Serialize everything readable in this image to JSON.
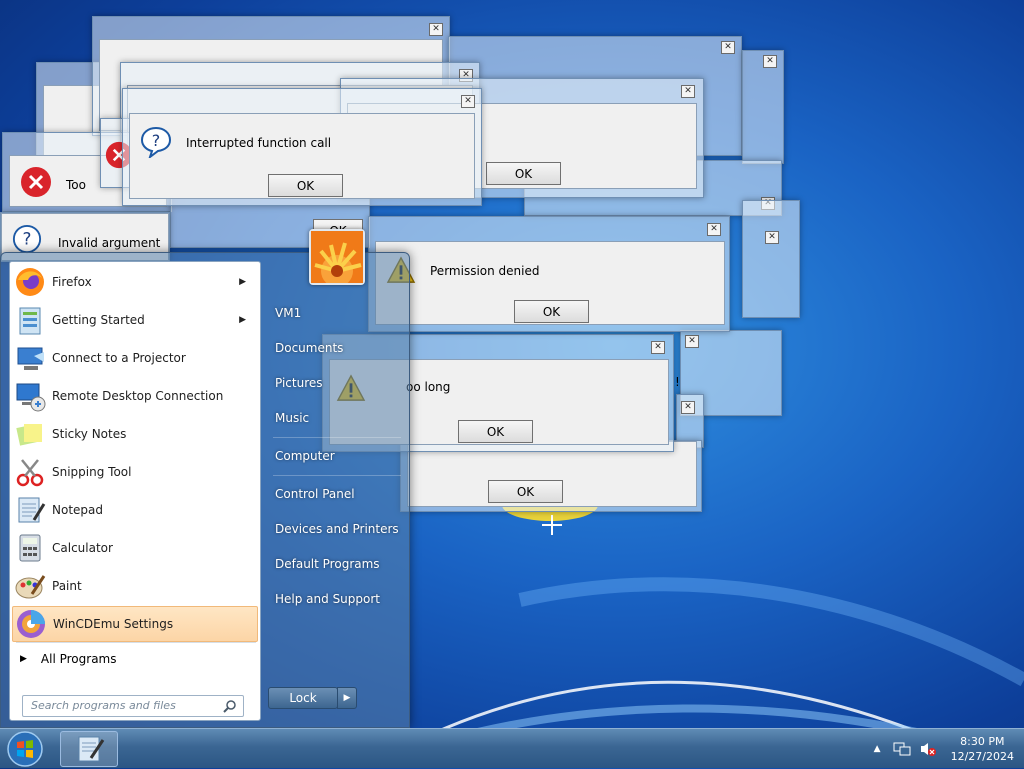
{
  "dialogs": {
    "interrupted": {
      "message": "Interrupted function call",
      "ok": "OK"
    },
    "invalid": {
      "message": "Invalid argument"
    },
    "permission": {
      "message": "Permission denied",
      "ok": "OK"
    },
    "toolong": {
      "message": "oo long",
      "ok": "OK"
    },
    "generic_ok": "OK",
    "partial_too": "Too",
    "partial_bang": "!"
  },
  "start_menu": {
    "programs": [
      {
        "label": "Firefox",
        "icon": "firefox-icon",
        "has_arrow": true
      },
      {
        "label": "Getting Started",
        "icon": "getting-started-icon",
        "has_arrow": true
      },
      {
        "label": "Connect to a Projector",
        "icon": "projector-icon",
        "has_arrow": false
      },
      {
        "label": "Remote Desktop Connection",
        "icon": "remote-desktop-icon",
        "has_arrow": false
      },
      {
        "label": "Sticky Notes",
        "icon": "sticky-notes-icon",
        "has_arrow": false
      },
      {
        "label": "Snipping Tool",
        "icon": "snipping-tool-icon",
        "has_arrow": false
      },
      {
        "label": "Notepad",
        "icon": "notepad-icon",
        "has_arrow": false
      },
      {
        "label": "Calculator",
        "icon": "calculator-icon",
        "has_arrow": false
      },
      {
        "label": "Paint",
        "icon": "paint-icon",
        "has_arrow": false
      },
      {
        "label": "WinCDEmu Settings",
        "icon": "wincdemu-icon",
        "has_arrow": false
      }
    ],
    "all_programs": "All Programs",
    "search_placeholder": "Search programs and files",
    "places": [
      "VM1",
      "Documents",
      "Pictures",
      "Music",
      "Computer",
      "Control Panel",
      "Devices and Printers",
      "Default Programs",
      "Help and Support"
    ],
    "lock": "Lock"
  },
  "taskbar": {
    "time": "8:30 PM",
    "date": "12/27/2024"
  },
  "colors": {
    "highlight": "#fcd5a6",
    "desktop": "#1a63c4"
  }
}
